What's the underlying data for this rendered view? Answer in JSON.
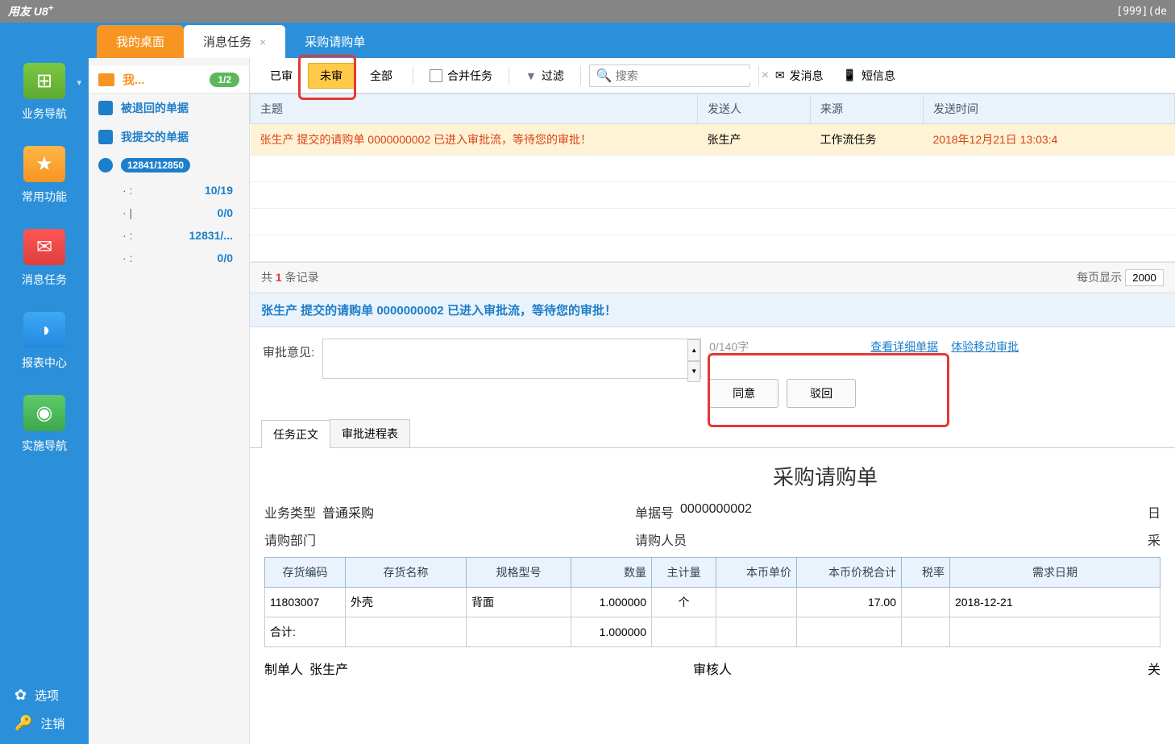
{
  "titlebar": {
    "app": "用友",
    "brand": "U8",
    "sup": "+",
    "user": "[999](de"
  },
  "sidebar": {
    "items": [
      {
        "label": "业务导航"
      },
      {
        "label": "常用功能"
      },
      {
        "label": "消息任务"
      },
      {
        "label": "报表中心"
      },
      {
        "label": "实施导航"
      }
    ],
    "bottom": {
      "options": "选项",
      "logout": "注销"
    }
  },
  "toptabs": {
    "desktop": "我的桌面",
    "msg": "消息任务",
    "purchase": "采购请购单"
  },
  "sidebar2": {
    "folder": "我...",
    "folder_badge": "1/2",
    "returned": "被退回的单据",
    "submitted": "我提交的单据",
    "chat_badge": "12841/12850",
    "subs": [
      {
        "dot": "·  :",
        "val": "10/19"
      },
      {
        "dot": "·  |",
        "val": "0/0"
      },
      {
        "dot": "·  :",
        "val": "12831/..."
      },
      {
        "dot": "·  :",
        "val": "0/0"
      }
    ]
  },
  "toolbar": {
    "approved": "已审",
    "pending": "未审",
    "all": "全部",
    "merge": "合并任务",
    "filter": "过滤",
    "search_ph": "搜索",
    "sendmsg": "发消息",
    "sms": "短信息"
  },
  "table": {
    "h_subject": "主题",
    "h_sender": "发送人",
    "h_source": "来源",
    "h_sent": "发送时间",
    "row": {
      "subject_a": "张生产 提交的请购单 ",
      "subject_num": "0000000002",
      "subject_b": " 已进入审批流，等待您的审批！",
      "sender": "张生产",
      "source": "工作流任务",
      "sent": "2018年12月21日 13:03:4"
    }
  },
  "pager": {
    "pre": "共 ",
    "cnt": "1",
    "post": " 条记录",
    "pglbl": "每页显示",
    "pgsize": "2000"
  },
  "detail": {
    "hdr_a": "张生产 提交的请购单 ",
    "hdr_num": "0000000002",
    "hdr_b": " 已进入审批流，等待您的审批！",
    "opinion_lbl": "审批意见:",
    "char_cnt": "0/140字",
    "agree": "同意",
    "reject": "驳回",
    "detail_link": "查看详细单据",
    "mobile_link": "体验移动审批",
    "tab_body": "任务正文",
    "tab_progress": "审批进程表"
  },
  "doc": {
    "title": "采购请购单",
    "f1_lbl": "业务类型",
    "f1_val": "普通采购",
    "f2_lbl": "单据号",
    "f2_val": "0000000002",
    "f3_lbl": "日",
    "f4_lbl": "请购部门",
    "f5_lbl": "请购人员",
    "f6_lbl": "采",
    "cols": {
      "code": "存货编码",
      "name": "存货名称",
      "spec": "规格型号",
      "qty": "数量",
      "unit": "主计量",
      "price": "本币单价",
      "amt": "本币价税合计",
      "tax": "税率",
      "reqdate": "需求日期"
    },
    "row": {
      "code": "11803007",
      "name": "外壳",
      "spec": "背面",
      "qty": "1.000000",
      "unit": "个",
      "amt": "17.00",
      "reqdate": "2018-12-21"
    },
    "total_lbl": "合计:",
    "total_qty": "1.000000",
    "maker_lbl": "制单人",
    "maker_val": "张生产",
    "auditor_lbl": "审核人",
    "closer_lbl": "关"
  }
}
